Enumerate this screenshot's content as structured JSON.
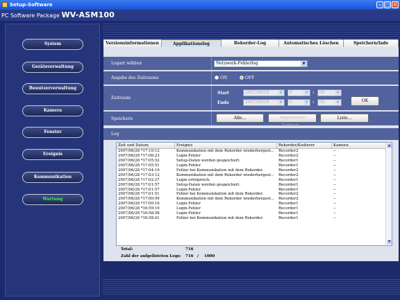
{
  "window": {
    "title": "Setup-Software"
  },
  "header": {
    "prefix": "PC Software Package",
    "model": "WV-ASM100"
  },
  "nav": [
    {
      "label": "System"
    },
    {
      "label": "Geräteverwaltung"
    },
    {
      "label": "Benutzerverwaltung"
    },
    {
      "label": "Kamera"
    },
    {
      "label": "Fenster"
    },
    {
      "label": "Ereignis"
    },
    {
      "label": "Kommunikation"
    },
    {
      "label": "Wartung",
      "active": true
    }
  ],
  "tabs": [
    {
      "label": "Versionsinformationen"
    },
    {
      "label": "Applikationslog",
      "active": true
    },
    {
      "label": "Rekorder-Log"
    },
    {
      "label": "Automatisches Löschen"
    },
    {
      "label": "Speichern/lade"
    }
  ],
  "form": {
    "logtype_label": "Logart wählen",
    "logtype_value": "Netzwerk-Fehlerlog",
    "timespec_label": "Angabe des Zeitraums",
    "on_label": "ON",
    "off_label": "OFF",
    "off_selected": true,
    "period_label": "Zeitraum",
    "start_label": "Start",
    "end_label": "Ende",
    "start_date": "2007/06/28",
    "start_hour": "0",
    "start_min": "00",
    "end_date": "2007/06/28",
    "end_hour": "0",
    "end_min": "00",
    "colon": ":",
    "ok_label": "OK",
    "save_label": "Speichern",
    "all_label": "Alle...",
    "range_label": "Angegebener Zeitraum...",
    "list_label": "Liste..."
  },
  "log": {
    "title": "Log",
    "columns": [
      "Zeit und Datum",
      "Ereignis",
      "Rekorder/Kodierer",
      "Kamera"
    ],
    "rows": [
      [
        "2007/06/28 *17:10:12",
        "Kommunikation mit dem Rekorder wiederhergest...",
        "Recorder2",
        "--"
      ],
      [
        "2007/06/28 *17:06:23",
        "Login-Fehler",
        "Recorder2",
        "--"
      ],
      [
        "2007/06/28 *17:05:52",
        "Setup-Daten werden gespeichert.",
        "Recorder1",
        "--"
      ],
      [
        "2007/06/28 *17:05:51",
        "Login-Fehler",
        "Recorder1",
        "--"
      ],
      [
        "2007/06/28 *17:04:19",
        "Fehler bei Kommunikation mit dem Rekorder.",
        "Recorder2",
        "--"
      ],
      [
        "2007/06/28 *17:03:12",
        "Kommunikation mit dem Rekorder wiederhergest...",
        "Recorder2",
        "--"
      ],
      [
        "2007/06/28 *17:02:27",
        "Login erfolgreich.",
        "Recorder1",
        "--"
      ],
      [
        "2007/06/28 *17:01:57",
        "Setup-Daten werden gespeichert.",
        "Recorder1",
        "--"
      ],
      [
        "2007/06/28 *17:01:57",
        "Login-Fehler",
        "Recorder1",
        "--"
      ],
      [
        "2007/06/28 *17:01:51",
        "Fehler bei Kommunikation mit dem Rekorder.",
        "Recorder2",
        "--"
      ],
      [
        "2007/06/28 *17:00:59",
        "Kommunikation mit dem Rekorder wiederhergest...",
        "Recorder2",
        "--"
      ],
      [
        "2007/06/28 *17:00:16",
        "Login-Fehler",
        "Recorder1",
        "--"
      ],
      [
        "2007/06/28 *16:59:10",
        "Login-Fehler",
        "Recorder1",
        "--"
      ],
      [
        "2007/06/28 *16:58:58",
        "Login-Fehler",
        "Recorder1",
        "--"
      ],
      [
        "2007/06/28 *16:58:41",
        "Fehler bei Kommunikation mit dem Rekorder.",
        "Recorder1",
        "--"
      ]
    ],
    "total_label": "Total:",
    "total_value": "716",
    "listed_label": "Zahl der aufgelisteten Logs:",
    "listed_value": "716",
    "slash": "/",
    "max_value": "1000"
  },
  "colors": {
    "nav_active": "#3bff3b",
    "tab_active_border": "#d79a2e",
    "panel_row": "#51629e"
  }
}
